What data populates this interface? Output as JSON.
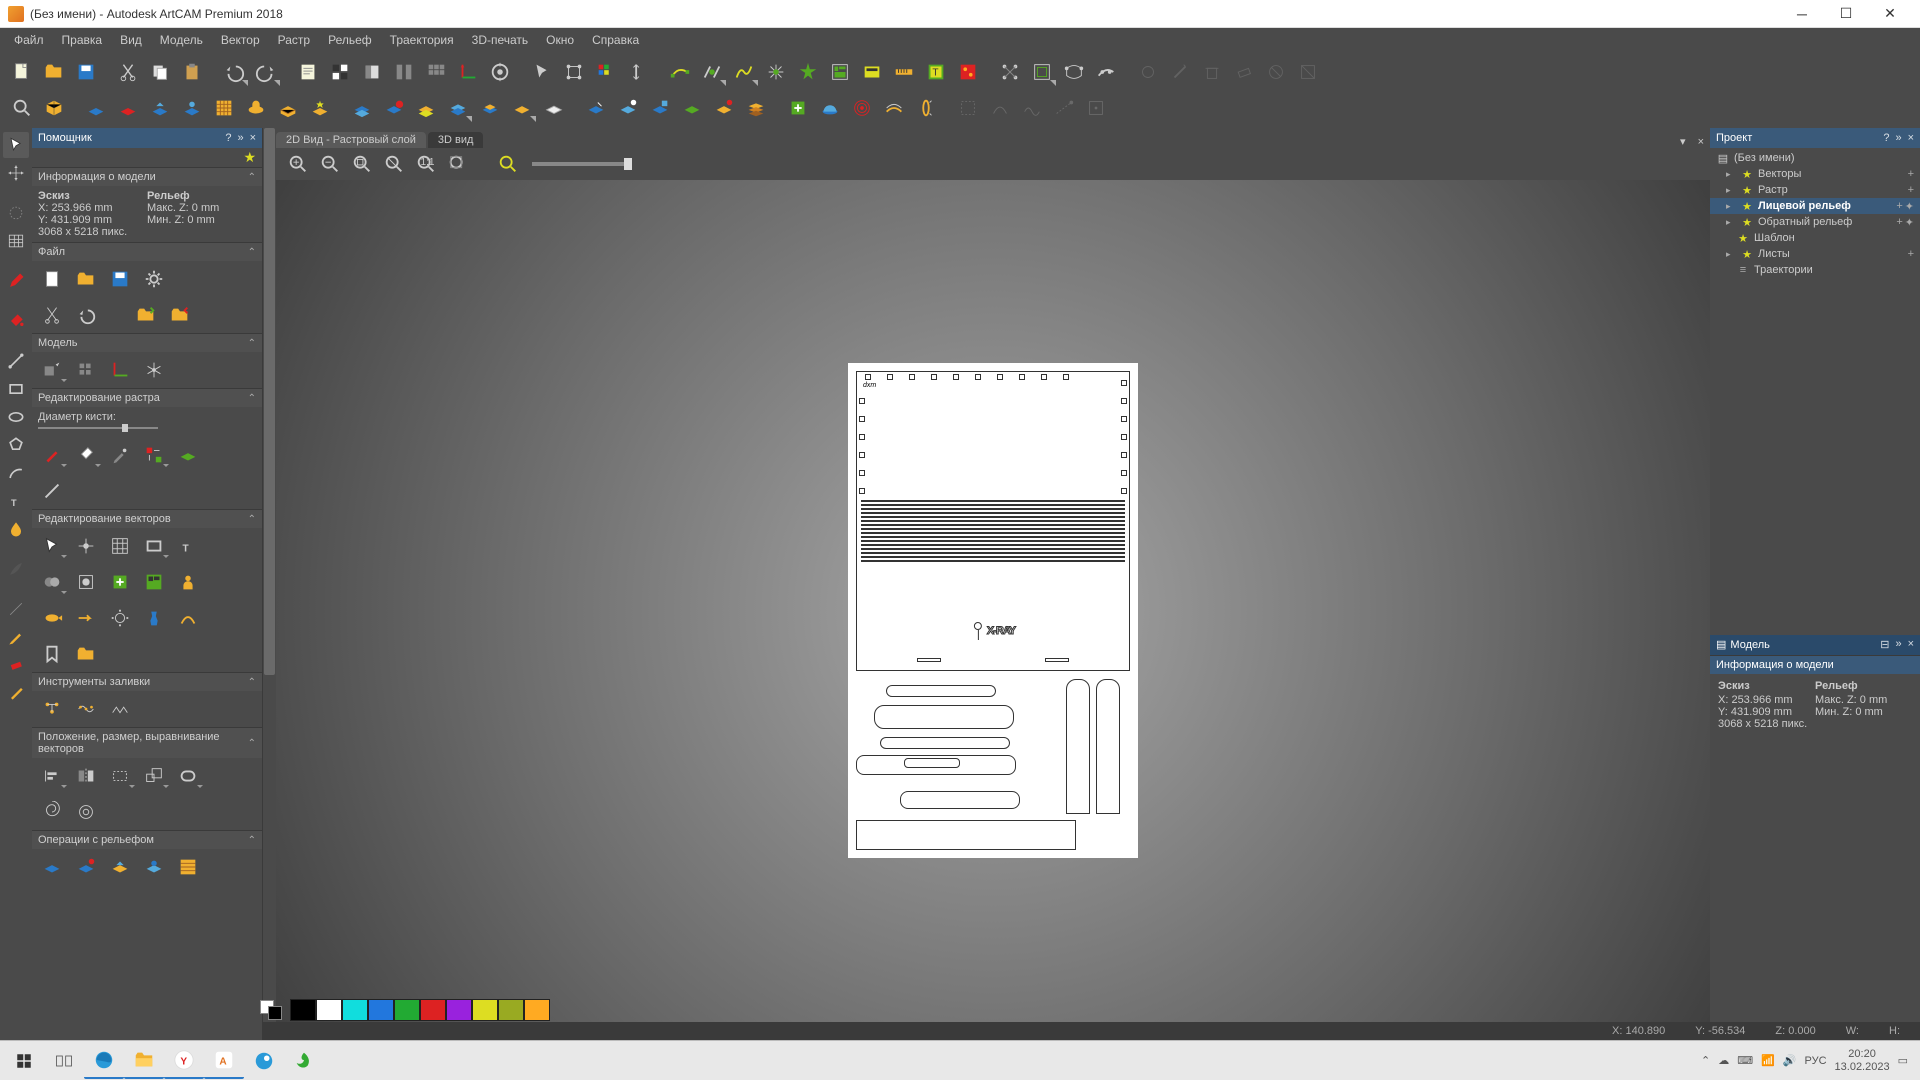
{
  "title": "(Без имени) - Autodesk ArtCAM Premium 2018",
  "menus": [
    "Файл",
    "Правка",
    "Вид",
    "Модель",
    "Вектор",
    "Растр",
    "Рельеф",
    "Траектория",
    "3D-печать",
    "Окно",
    "Справка"
  ],
  "left": {
    "assistant": "Помощник",
    "modelinfo": {
      "title": "Информация о модели",
      "sketch_label": "Эскиз",
      "relief_label": "Рельеф",
      "x": "X: 253.966 mm",
      "y": "Y: 431.909 mm",
      "dims": "3068 x 5218 пикс.",
      "maxz": "Макс. Z: 0 mm",
      "minz": "Мин. Z: 0 mm"
    },
    "file": "Файл",
    "model": "Модель",
    "raster": "Редактирование растра",
    "brush_label": "Диаметр кисти:",
    "vectors": "Редактирование векторов",
    "fill": "Инструменты заливки",
    "pos": "Положение, размер, выравнивание векторов",
    "relief_ops": "Операции с рельефом"
  },
  "tabs": {
    "t1": "2D Вид - Растровый слой",
    "t2": "3D вид"
  },
  "artboard_text": "X-RAY",
  "project": {
    "title": "Проект",
    "root": "(Без имени)",
    "items": [
      {
        "label": "Векторы",
        "star": true,
        "plus": true
      },
      {
        "label": "Растр",
        "star": true,
        "plus": true
      },
      {
        "label": "Лицевой рельеф",
        "star": true,
        "sel": true,
        "plus": true,
        "dbl": true
      },
      {
        "label": "Обратный рельеф",
        "star": true,
        "plus": true
      },
      {
        "label": "Шаблон",
        "star": true
      },
      {
        "label": "Листы",
        "star": true
      },
      {
        "label": "Траектории"
      }
    ]
  },
  "modelpanel": {
    "title": "Модель",
    "info": "Информация о модели",
    "sketch_label": "Эскиз",
    "relief_label": "Рельеф",
    "x": "X: 253.966 mm",
    "y": "Y: 431.909 mm",
    "dims": "3068 x 5218 пикс.",
    "maxz": "Макс. Z: 0 mm",
    "minz": "Мин. Z: 0 mm"
  },
  "status": {
    "x": "X: 140.890",
    "y": "Y: -56.534",
    "z": "Z: 0.000",
    "w": "W:",
    "h": "H:"
  },
  "swatches": [
    "#000",
    "#fff",
    "#1dd",
    "#27d",
    "#2a3",
    "#d22",
    "#92d",
    "#dd2",
    "#9a2",
    "#fa2"
  ],
  "tray": {
    "lang": "РУС",
    "time": "20:20",
    "date": "13.02.2023"
  }
}
